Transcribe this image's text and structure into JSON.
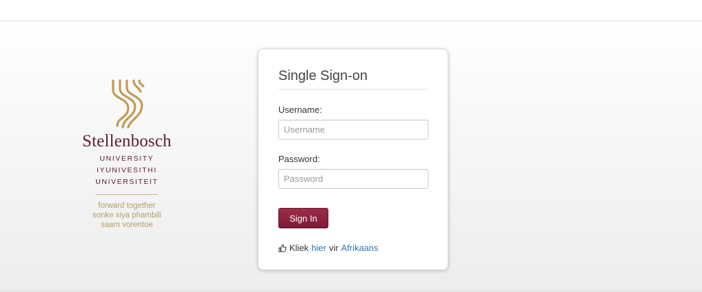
{
  "logo": {
    "name": "Stellenbosch",
    "university_lines": [
      "UNIVERSITY",
      "IYUNIVESITHI",
      "UNIVERSITEIT"
    ],
    "motto_lines": [
      "forward together",
      "sonke siya phambili",
      "saam vorentoe"
    ],
    "colors": {
      "maroon": "#5e1a33",
      "gold": "#b59e6a"
    }
  },
  "login": {
    "title": "Single Sign-on",
    "username_label": "Username:",
    "username_placeholder": "Username",
    "username_value": "",
    "password_label": "Password:",
    "password_placeholder": "Password",
    "password_value": "",
    "signin_label": "Sign In",
    "button_color": "#8a2440",
    "language": {
      "icon": "thumbs-up-icon",
      "prefix": "Kliek",
      "link1": "hier",
      "middle": "vir",
      "link2": "Afrikaans"
    }
  }
}
